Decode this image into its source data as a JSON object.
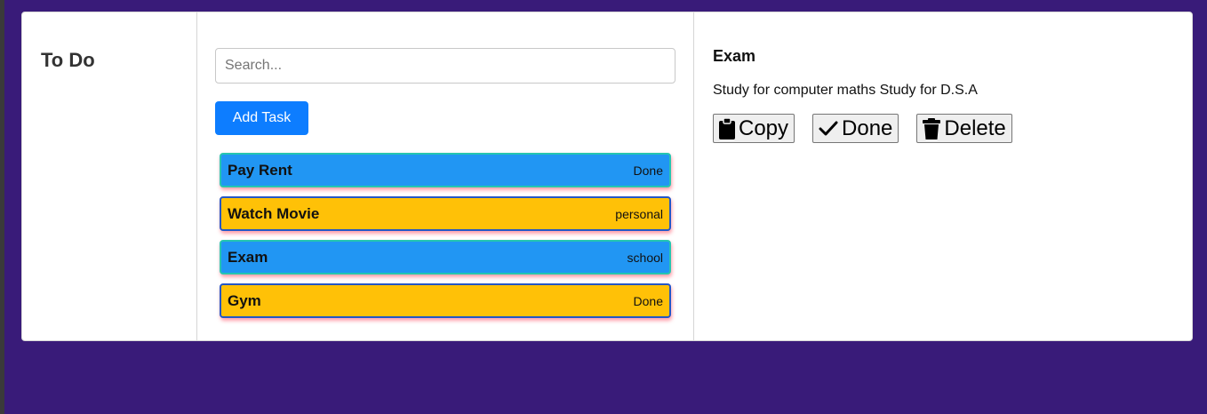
{
  "app": {
    "brand": "To Do"
  },
  "search": {
    "placeholder": "Search...",
    "value": ""
  },
  "toolbar": {
    "add_label": "Add Task"
  },
  "tasks": [
    {
      "title": "Pay Rent",
      "tag": "Done",
      "color": "blue"
    },
    {
      "title": "Watch Movie",
      "tag": "personal",
      "color": "yellow"
    },
    {
      "title": "Exam",
      "tag": "school",
      "color": "blue"
    },
    {
      "title": "Gym",
      "tag": "Done",
      "color": "yellow"
    }
  ],
  "detail": {
    "title": "Exam",
    "description": "Study for computer maths Study for D.S.A",
    "actions": {
      "copy_label": "Copy",
      "copy_icon": "clipboard-icon",
      "done_label": "Done",
      "done_icon": "check-icon",
      "delete_label": "Delete",
      "delete_icon": "trash-icon"
    }
  },
  "colors": {
    "background": "#391b79",
    "accent": "#0d7dff",
    "task_blue": "#2196f3",
    "task_yellow": "#ffc107"
  }
}
